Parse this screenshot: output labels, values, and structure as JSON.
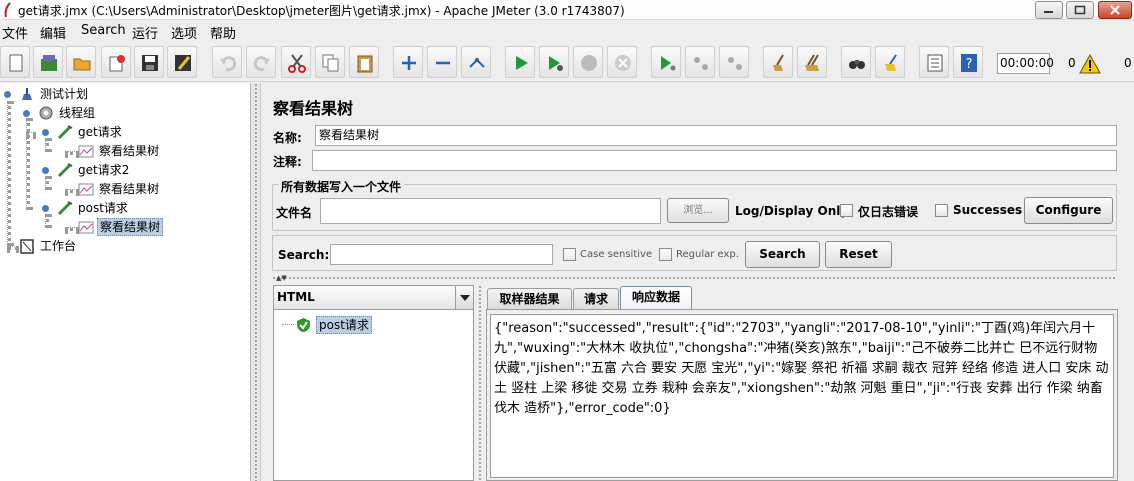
{
  "window": {
    "title": "get请求.jmx (C:\\Users\\Administrator\\Desktop\\jmeter图片\\get请求.jmx) - Apache JMeter (3.0 r1743807)"
  },
  "menu": [
    "文件",
    "编辑",
    "Search",
    "运行",
    "选项",
    "帮助"
  ],
  "toolbar": {
    "timer": "00:00:00",
    "error_count": "0",
    "thread_count": "0",
    "buttons": [
      "new",
      "templates",
      "open",
      "close",
      "save",
      "save-as",
      "undo",
      "redo",
      "cut",
      "copy",
      "paste",
      "expand",
      "collapse",
      "toggle",
      "start",
      "start-no-pause",
      "stop",
      "shutdown",
      "remote-start-all",
      "remote-stop-all",
      "remote-shutdown-all",
      "clear",
      "clear-all",
      "search",
      "reset-search",
      "function-helper",
      "help"
    ]
  },
  "tree": {
    "nodes": [
      {
        "label": "测试计划",
        "icon": "test-plan-icon"
      },
      {
        "label": "线程组",
        "icon": "thread-group-icon"
      },
      {
        "label": "get请求",
        "icon": "http-sampler-icon"
      },
      {
        "label": "察看结果树",
        "icon": "listener-icon"
      },
      {
        "label": "get请求2",
        "icon": "http-sampler-icon"
      },
      {
        "label": "察看结果树",
        "icon": "listener-icon"
      },
      {
        "label": "post请求",
        "icon": "http-sampler-icon"
      },
      {
        "label": "察看结果树",
        "icon": "listener-icon",
        "selected": true
      },
      {
        "label": "工作台",
        "icon": "workbench-icon"
      }
    ]
  },
  "panel": {
    "heading": "察看结果树",
    "name_label": "名称:",
    "name_value": "察看结果树",
    "comment_label": "注释:",
    "comment_value": "",
    "file_group_title": "所有数据写入一个文件",
    "filename_label": "文件名",
    "filename_value": "",
    "browse_label": "浏览...",
    "log_display_label": "Log/Display Only:",
    "errors_only_label": "仅日志错误",
    "successes_label": "Successes",
    "configure_label": "Configure"
  },
  "search": {
    "label": "Search:",
    "value": "",
    "case_sensitive_label": "Case sensitive",
    "regex_label": "Regular exp.",
    "search_button": "Search",
    "reset_button": "Reset"
  },
  "results": {
    "renderer": "HTML",
    "sampler_label": "post请求",
    "tabs": [
      "取样器结果",
      "请求",
      "响应数据"
    ],
    "active_tab": "响应数据",
    "response_text": "{\"reason\":\"successed\",\"result\":{\"id\":\"2703\",\"yangli\":\"2017-08-10\",\"yinli\":\"丁酉(鸡)年闰六月十九\",\"wuxing\":\"大林木 收执位\",\"chongsha\":\"冲猪(癸亥)煞东\",\"baiji\":\"己不破券二比并亡 巳不远行财物伏藏\",\"jishen\":\"五富 六合 要安 天愿 宝光\",\"yi\":\"嫁娶 祭祀 祈福 求嗣 裁衣 冠笄 经络 修造 进人口 安床 动土 竖柱 上梁 移徙 交易 立券 栽种 会亲友\",\"xiongshen\":\"劫煞 河魁 重日\",\"ji\":\"行丧 安葬 出行 作梁 纳畜 伐木 造桥\"},\"error_code\":0}"
  },
  "colors": {
    "selection": "#b8cfe5",
    "success_badge": "#2a9a2a",
    "close_button": "#c8442d"
  }
}
